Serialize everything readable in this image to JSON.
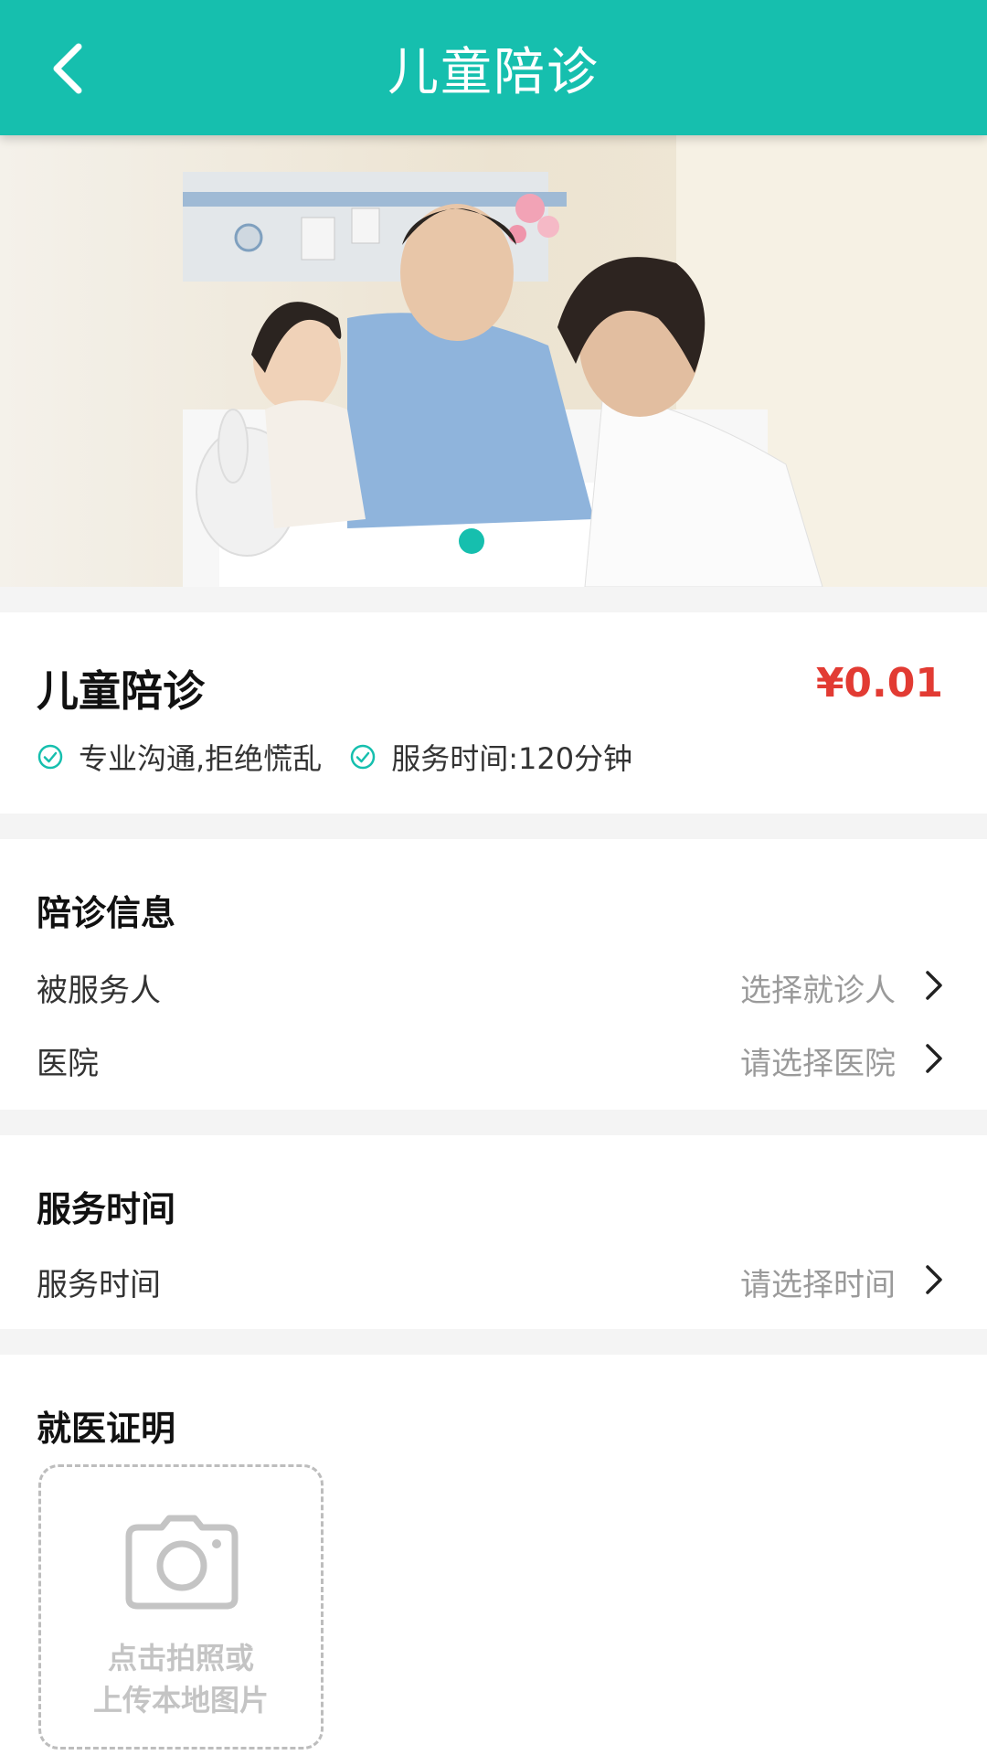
{
  "navbar": {
    "title": "儿童陪诊"
  },
  "banner": {
    "total_slides": 2,
    "active_slide": 1
  },
  "product": {
    "name": "儿童陪诊",
    "price": "¥0.01",
    "tags": [
      "专业沟通,拒绝慌乱",
      "服务时间:120分钟"
    ]
  },
  "info": {
    "title": "陪诊信息",
    "patient": {
      "label": "被服务人",
      "value": "选择就诊人"
    },
    "hospital": {
      "label": "医院",
      "value": "请选择医院"
    }
  },
  "service_time": {
    "title": "服务时间",
    "row": {
      "label": "服务时间",
      "value": "请选择时间"
    }
  },
  "proof": {
    "title": "就医证明",
    "upload_line1": "点击拍照或",
    "upload_line2": "上传本地图片"
  },
  "colors": {
    "accent": "#16bfae",
    "price": "#e23b33"
  }
}
